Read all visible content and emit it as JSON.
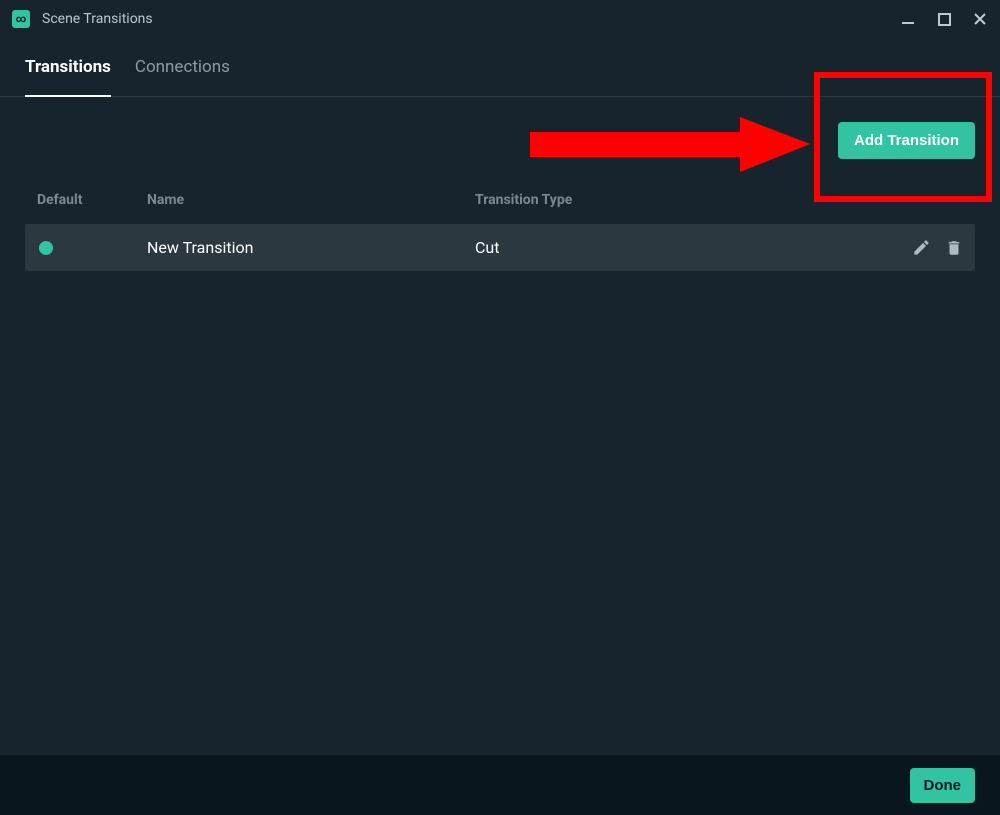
{
  "titlebar": {
    "title": "Scene Transitions"
  },
  "tabs": {
    "transitions": "Transitions",
    "connections": "Connections",
    "active_index": 0
  },
  "buttons": {
    "add": "Add Transition",
    "done": "Done"
  },
  "table": {
    "headers": {
      "default": "Default",
      "name": "Name",
      "type": "Transition Type"
    },
    "rows": [
      {
        "is_default": true,
        "name": "New Transition",
        "type": "Cut"
      }
    ]
  },
  "colors": {
    "accent": "#31c3a2",
    "bg": "#17242d",
    "footer_bg": "#09161d",
    "row_bg": "#2b383f",
    "highlight": "#ff0000"
  }
}
